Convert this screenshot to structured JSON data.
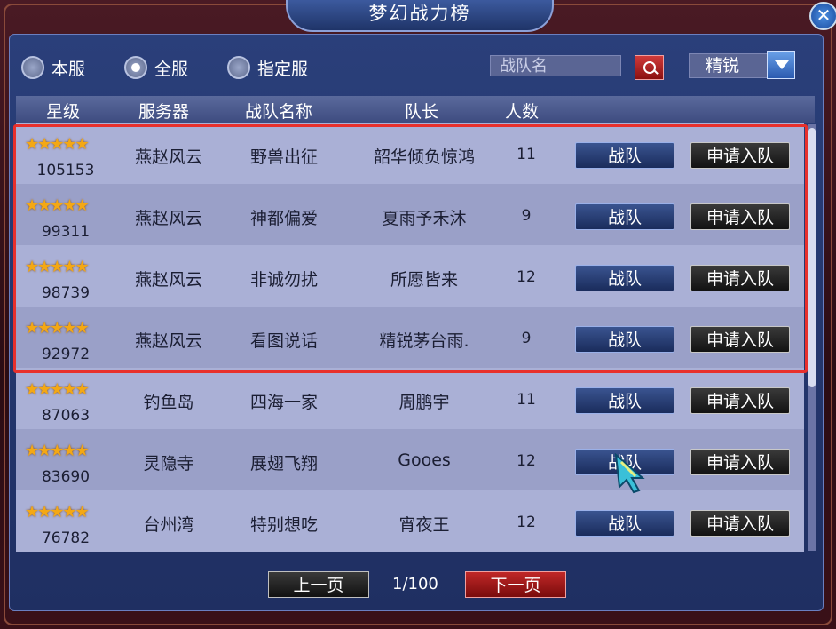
{
  "window": {
    "title": "梦幻战力榜",
    "close_label": "✕"
  },
  "filters": {
    "options": [
      {
        "label": "本服",
        "selected": false
      },
      {
        "label": "全服",
        "selected": true
      },
      {
        "label": "指定服",
        "selected": false
      }
    ],
    "search_placeholder": "战队名",
    "dropdown_value": "精锐"
  },
  "table": {
    "headers": {
      "star": "星级",
      "server": "服务器",
      "team": "战队名称",
      "captain": "队长",
      "count": "人数"
    },
    "rows": [
      {
        "stars": "★★★★★",
        "score": "105153",
        "server": "燕赵风云",
        "team": "野兽出征",
        "captain": "韶华倾负惊鸿",
        "count": "11",
        "team_btn": "战队",
        "apply_btn": "申请入队"
      },
      {
        "stars": "★★★★★",
        "score": "99311",
        "server": "燕赵风云",
        "team": "神都偏爱",
        "captain": "夏雨予禾沐",
        "count": "9",
        "team_btn": "战队",
        "apply_btn": "申请入队"
      },
      {
        "stars": "★★★★★",
        "score": "98739",
        "server": "燕赵风云",
        "team": "非诚勿扰",
        "captain": "所愿皆来",
        "count": "12",
        "team_btn": "战队",
        "apply_btn": "申请入队"
      },
      {
        "stars": "★★★★★",
        "score": "92972",
        "server": "燕赵风云",
        "team": "看图说话",
        "captain": "精锐茅台雨.",
        "count": "9",
        "team_btn": "战队",
        "apply_btn": "申请入队"
      },
      {
        "stars": "★★★★★",
        "score": "87063",
        "server": "钓鱼岛",
        "team": "四海一家",
        "captain": "周鹏宇",
        "count": "11",
        "team_btn": "战队",
        "apply_btn": "申请入队"
      },
      {
        "stars": "★★★★★",
        "score": "83690",
        "server": "灵隐寺",
        "team": "展翅飞翔",
        "captain": "Gooes",
        "count": "12",
        "team_btn": "战队",
        "apply_btn": "申请入队"
      },
      {
        "stars": "★★★★★",
        "score": "76782",
        "server": "台州湾",
        "team": "特别想吃",
        "captain": "宵夜王",
        "count": "12",
        "team_btn": "战队",
        "apply_btn": "申请入队"
      }
    ]
  },
  "pager": {
    "prev": "上一页",
    "page": "1/100",
    "next": "下一页"
  },
  "colors": {
    "highlight": "#e8302c",
    "star": "#f4a814"
  }
}
